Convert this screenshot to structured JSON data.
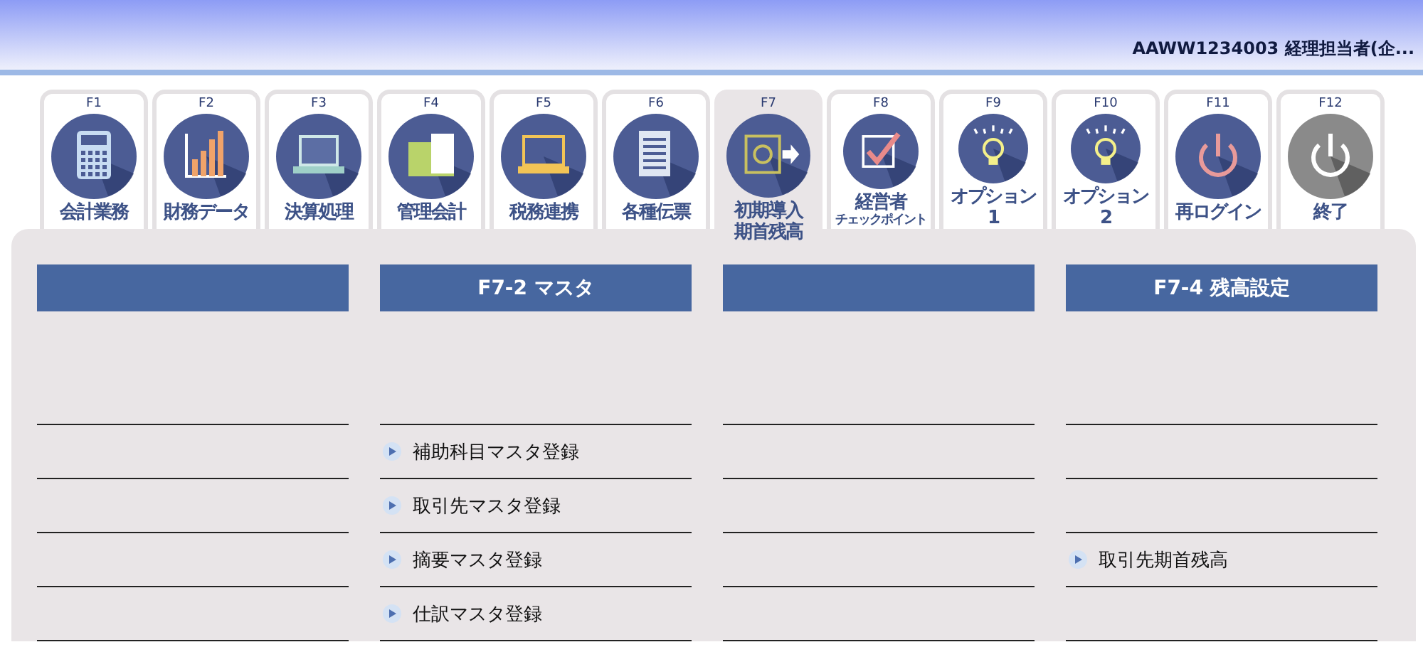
{
  "header": {
    "user": "AAWW1234003 経理担当者(企..."
  },
  "tabs": [
    {
      "key": "F1",
      "lines": [
        "会計業務"
      ],
      "selected": false
    },
    {
      "key": "F2",
      "lines": [
        "財務データ"
      ],
      "selected": false
    },
    {
      "key": "F3",
      "lines": [
        "決算処理"
      ],
      "selected": false
    },
    {
      "key": "F4",
      "lines": [
        "管理会計"
      ],
      "selected": false
    },
    {
      "key": "F5",
      "lines": [
        "税務連携"
      ],
      "selected": false
    },
    {
      "key": "F6",
      "lines": [
        "各種伝票"
      ],
      "selected": false
    },
    {
      "key": "F7",
      "lines": [
        "初期導入",
        "期首残高"
      ],
      "selected": true
    },
    {
      "key": "F8",
      "lines": [
        "経営者"
      ],
      "subline": "チェックポイント",
      "selected": false
    },
    {
      "key": "F9",
      "lines": [
        "オプション",
        "1"
      ],
      "selected": false
    },
    {
      "key": "F10",
      "lines": [
        "オプション",
        "2"
      ],
      "selected": false
    },
    {
      "key": "F11",
      "lines": [
        "再ログイン"
      ],
      "selected": false
    },
    {
      "key": "F12",
      "lines": [
        "終了"
      ],
      "selected": false
    }
  ],
  "columns": [
    {
      "rows": [
        {
          "kind": "empty"
        },
        {
          "kind": "empty"
        },
        {
          "kind": "empty"
        },
        {
          "kind": "empty"
        }
      ]
    },
    {
      "title": "F7-2 マスタ",
      "rows": [
        {
          "kind": "link",
          "label": "補助科目マスタ登録"
        },
        {
          "kind": "link",
          "label": "取引先マスタ登録"
        },
        {
          "kind": "link",
          "label": "摘要マスタ登録"
        },
        {
          "kind": "link",
          "label": "仕訳マスタ登録"
        }
      ]
    },
    {
      "rows": [
        {
          "kind": "empty"
        },
        {
          "kind": "empty"
        },
        {
          "kind": "empty"
        },
        {
          "kind": "empty"
        }
      ]
    },
    {
      "title": "F7-4 残高設定",
      "rows": [
        {
          "kind": "empty"
        },
        {
          "kind": "empty"
        },
        {
          "kind": "link",
          "label": "取引先期首残高"
        },
        {
          "kind": "empty"
        }
      ]
    }
  ]
}
